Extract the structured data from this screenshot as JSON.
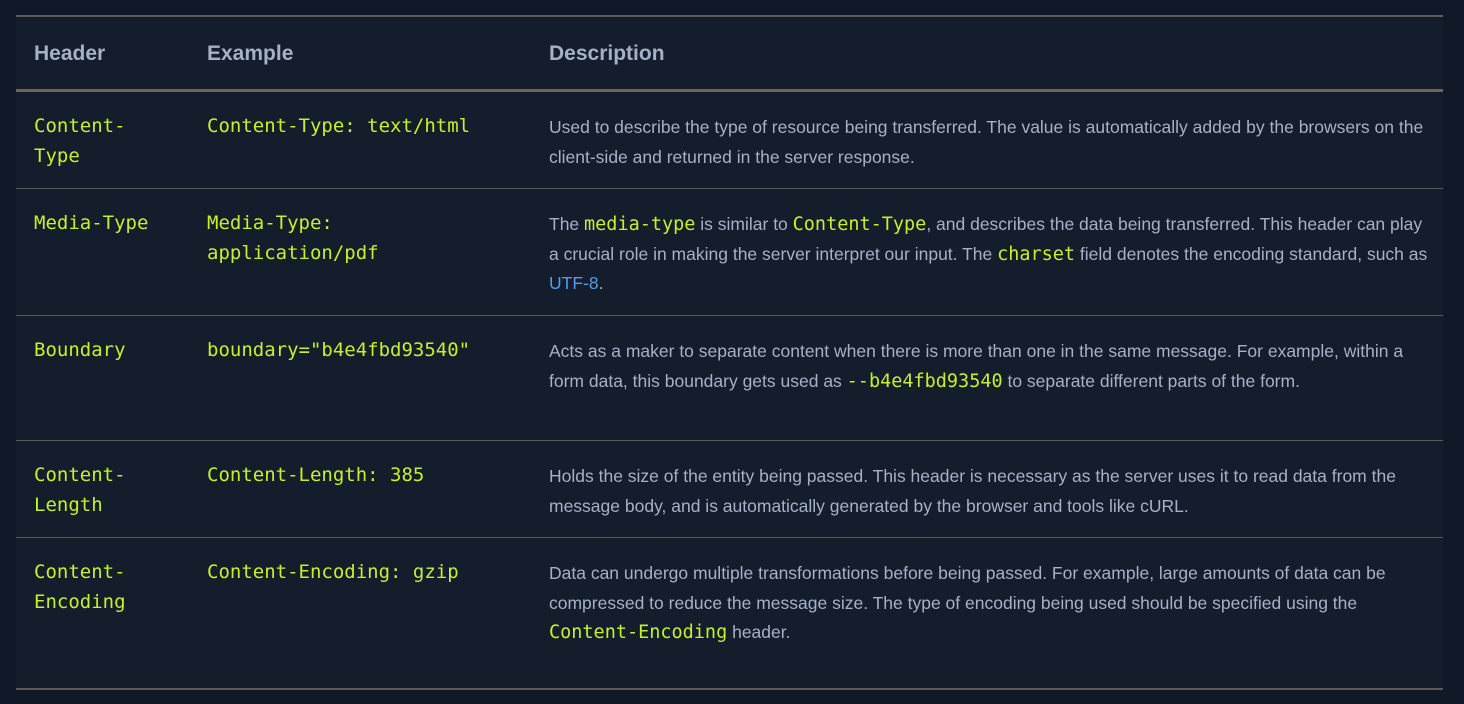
{
  "columns": {
    "header": "Header",
    "example": "Example",
    "description": "Description"
  },
  "rows": [
    {
      "header": "Content-\nType",
      "example": "Content-Type: text/html",
      "description": {
        "text": "Used to describe the type of resource being transferred. The value is automatically added by the browsers on the client-side and returned in the server response."
      }
    },
    {
      "header": "Media-Type",
      "example": "Media-Type:\napplication/pdf",
      "description": {
        "p1": "The ",
        "code1": "media-type",
        "p2": " is similar to ",
        "code2": "Content-Type",
        "p3": ", and describes the data being transferred. This header can play a crucial role in making the server interpret our input. The ",
        "code3": "charset",
        "p4": " field denotes the encoding standard, such as ",
        "link": "UTF-8",
        "p5": "."
      }
    },
    {
      "header": "Boundary",
      "example": "boundary=\"b4e4fbd93540\"",
      "description": {
        "p1": "Acts as a maker to separate content when there is more than one in the same message. For example, within a form data, this boundary gets used as ",
        "code1": "--b4e4fbd93540",
        "p2": " to separate different parts of the form."
      }
    },
    {
      "header": "Content-\nLength",
      "example": "Content-Length: 385",
      "description": {
        "text": "Holds the size of the entity being passed. This header is necessary as the server uses it to read data from the message body, and is automatically generated by the browser and tools like cURL."
      }
    },
    {
      "header": "Content-\nEncoding",
      "example": "Content-Encoding: gzip",
      "description": {
        "p1": "Data can undergo multiple transformations before being passed. For example, large amounts of data can be compressed to reduce the message size. The type of encoding being used should be specified using the ",
        "code1": "Content-Encoding",
        "p2": " header."
      }
    }
  ]
}
